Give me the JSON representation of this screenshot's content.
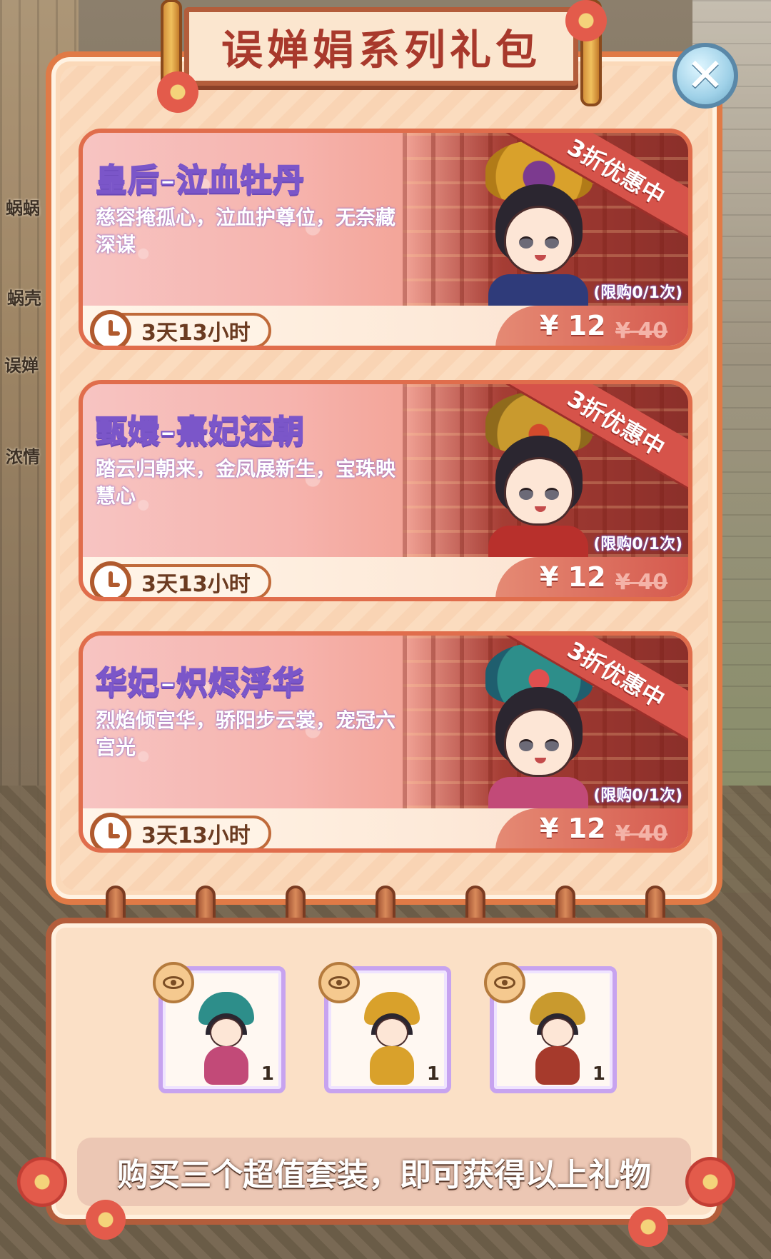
{
  "background": {
    "signs": [
      "蜗蜗",
      "蜗壳",
      "误婵",
      "浓情"
    ]
  },
  "title": "误婵娟系列礼包",
  "close_icon_glyph": "✕",
  "colors": {
    "panel_border": "#e07a46",
    "card_border": "#e06d4c",
    "title_text": "#a8392c",
    "title_card_stroke": "#7b56c9",
    "price_bg": "#d55a4e"
  },
  "cards": [
    {
      "title": "皇后–泣血牡丹",
      "desc": "慈容掩孤心，泣血护尊位，无奈藏深谋",
      "ribbon": "3折优惠中",
      "limit": "(限购0/1次)",
      "timer": "3天13小时",
      "price": "¥ 12",
      "old_price": "¥ 40",
      "crown_color": "#d9a12b",
      "robe_color": "#2f3b7a"
    },
    {
      "title": "甄嬛–熹妃还朝",
      "desc": "踏云归朝来，金凤展新生，宝珠映慧心",
      "ribbon": "3折优惠中",
      "limit": "(限购0/1次)",
      "timer": "3天13小时",
      "price": "¥ 12",
      "old_price": "¥ 40",
      "crown_color": "#c99a2e",
      "robe_color": "#b8302c"
    },
    {
      "title": "华妃–炽烬浮华",
      "desc": "烈焰倾宫华，骄阳步云裳，宠冠六宫光",
      "ribbon": "3折优惠中",
      "limit": "(限购0/1次)",
      "timer": "3天13小时",
      "price": "¥ 12",
      "old_price": "¥ 40",
      "crown_color": "#2d8e8a",
      "robe_color": "#c24a78"
    }
  ],
  "rewards": [
    {
      "count": "1",
      "crown_color": "#2d8e8a",
      "body_color": "#c24a78",
      "icon": "eye-icon"
    },
    {
      "count": "1",
      "crown_color": "#d9a12b",
      "body_color": "#d9a12b",
      "icon": "eye-icon"
    },
    {
      "count": "1",
      "crown_color": "#c99a2e",
      "body_color": "#a63a2c",
      "icon": "eye-icon"
    }
  ],
  "reward_note": "购买三个超值套装，即可获得以上礼物"
}
